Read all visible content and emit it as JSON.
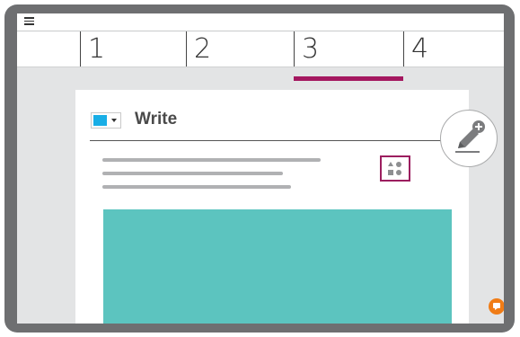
{
  "header": {
    "menu_icon": "hamburger-menu-icon"
  },
  "tabs": [
    {
      "label": "1",
      "selected": false
    },
    {
      "label": "2",
      "selected": false
    },
    {
      "label": "3",
      "selected": true
    },
    {
      "label": "4",
      "selected": false
    }
  ],
  "editor": {
    "title": "Write",
    "color_picker": {
      "selected_color": "#19aee6"
    },
    "insert_button_icon": "shapes-icon",
    "media_block_color": "#5cc4bf"
  },
  "floating": {
    "add_pen_icon": "add-pen-icon",
    "chat_icon": "chat-bubble-icon"
  },
  "colors": {
    "accent": "#a4175f",
    "frame": "#6e6f71",
    "chat": "#f07c16"
  }
}
